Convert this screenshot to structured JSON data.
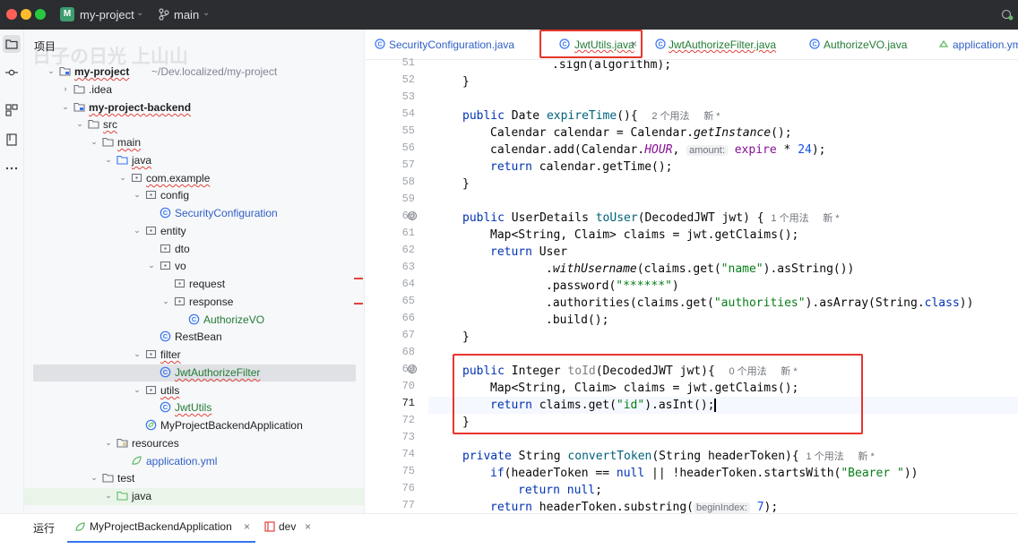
{
  "titlebar": {
    "project_badge": "M",
    "project_name": "my-project",
    "branch": "main"
  },
  "tree": {
    "title": "项目",
    "watermark": "日子の日光 上山山",
    "rows": [
      {
        "label": "my-project",
        "extra": "~/Dev.localized/my-project"
      },
      {
        "label": ".idea"
      },
      {
        "label": "my-project-backend"
      },
      {
        "label": "src"
      },
      {
        "label": "main"
      },
      {
        "label": "java"
      },
      {
        "label": "com.example"
      },
      {
        "label": "config"
      },
      {
        "label": "SecurityConfiguration"
      },
      {
        "label": "entity"
      },
      {
        "label": "dto"
      },
      {
        "label": "vo"
      },
      {
        "label": "request"
      },
      {
        "label": "response"
      },
      {
        "label": "AuthorizeVO"
      },
      {
        "label": "RestBean"
      },
      {
        "label": "filter"
      },
      {
        "label": "JwtAuthorizeFilter"
      },
      {
        "label": "utils"
      },
      {
        "label": "JwtUtils"
      },
      {
        "label": "MyProjectBackendApplication"
      },
      {
        "label": "resources"
      },
      {
        "label": "application.yml"
      },
      {
        "label": "test"
      },
      {
        "label": "java"
      }
    ]
  },
  "tabs": [
    {
      "label": "SecurityConfiguration.java"
    },
    {
      "label": "JwtUtils.java"
    },
    {
      "label": "JwtAuthorizeFilter.java"
    },
    {
      "label": "AuthorizeVO.java"
    },
    {
      "label": "application.ym"
    }
  ],
  "editor": {
    "line_numbers": [
      "51",
      "52",
      "53",
      "54",
      "55",
      "56",
      "57",
      "58",
      "59",
      "60",
      "61",
      "62",
      "63",
      "64",
      "65",
      "66",
      "67",
      "68",
      "69",
      "70",
      "71",
      "72",
      "73",
      "74",
      "75",
      "76",
      "77"
    ],
    "current_line": "71",
    "hints": {
      "usage2": "2 个用法",
      "usage1": "1 个用法",
      "usage0": "0 个用法",
      "new": "新 *",
      "amount": "amount:",
      "beginIndex": "beginIndex:"
    },
    "code": {
      "l51": ".sign(algorithm);",
      "l52": "}",
      "l54_kw": "public ",
      "l54_type": "Date ",
      "l54_fn": "expireTime",
      "l54_rest": "(){",
      "l55_a": "Calendar calendar = Calendar.",
      "l55_fn": "getInstance",
      "l55_b": "();",
      "l56_a": "calendar.add(Calendar.",
      "l56_st": "HOUR",
      "l56_b": ", ",
      "l56_f": "expire",
      "l56_c": " * ",
      "l56_n": "24",
      "l56_d": ");",
      "l57_kw": "return ",
      "l57_rest": "calendar.getTime();",
      "l58": "}",
      "l60_kw": "public ",
      "l60_type": "UserDetails ",
      "l60_fn": "toUser",
      "l60_rest": "(DecodedJWT jwt) {",
      "l61": "Map<String, Claim> claims = jwt.getClaims();",
      "l62_kw": "return ",
      "l62_rest": "User",
      "l63_a": ".",
      "l63_fn": "withUsername",
      "l63_b": "(claims.get(",
      "l63_s": "\"name\"",
      "l63_c": ").asString())",
      "l64_a": ".password(",
      "l64_s": "\"******\"",
      "l64_b": ")",
      "l65_a": ".authorities(claims.get(",
      "l65_s": "\"authorities\"",
      "l65_b": ").asArray(String.",
      "l65_kw": "class",
      "l65_c": "))",
      "l66": ".build();",
      "l67": "}",
      "l69_kw": "public ",
      "l69_type": "Integer ",
      "l69_fn": "toId",
      "l69_rest": "(DecodedJWT jwt){",
      "l70": "Map<String, Claim> claims = jwt.getClaims();",
      "l71_kw": "return ",
      "l71_a": "claims.get(",
      "l71_s": "\"id\"",
      "l71_b": ").asInt();",
      "l72": "}",
      "l74_kw": "private ",
      "l74_type": "String ",
      "l74_fn": "convertToken",
      "l74_rest": "(String headerToken){",
      "l75_kw": "if",
      "l75_a": "(headerToken == ",
      "l75_kw2": "null",
      "l75_b": " || !headerToken.startsWith(",
      "l75_s": "\"Bearer \"",
      "l75_c": "))",
      "l76_kw": "return ",
      "l76_kw2": "null",
      "l76_b": ";",
      "l77_kw": "return ",
      "l77_a": "headerToken.substring(",
      "l77_n": "7",
      "l77_b": ");"
    }
  },
  "bottom": {
    "run_label": "运行",
    "run_tab1": "MyProjectBackendApplication",
    "run_tab2": "dev"
  },
  "colors": {
    "accent": "#3574f0",
    "highlight_red": "#e8342c",
    "keyword": "#0033b3",
    "string": "#067d17"
  }
}
